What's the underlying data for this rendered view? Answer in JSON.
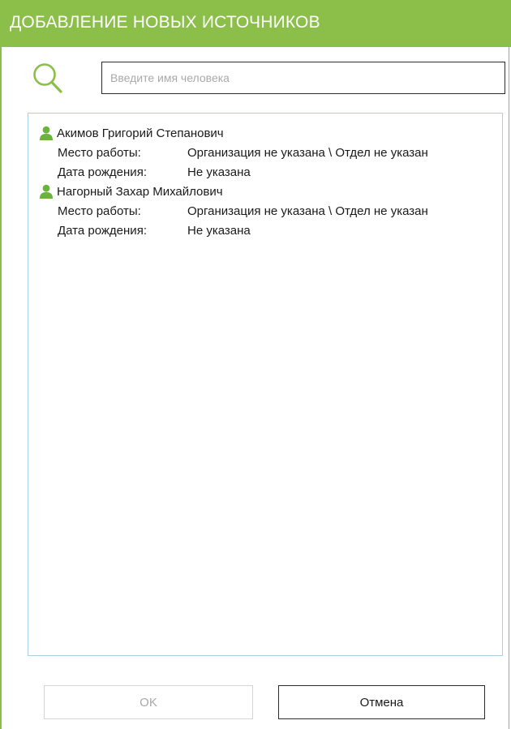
{
  "window": {
    "title": "ДОБАВЛЕНИЕ НОВЫХ ИСТОЧНИКОВ",
    "accent_color": "#8bbf4a"
  },
  "search": {
    "placeholder": "Введите имя человека",
    "value": "",
    "icon": "search-icon"
  },
  "people": [
    {
      "name": "Акимов Григорий Степанович",
      "icon": "person-icon",
      "workplace_label": "Место работы:",
      "workplace_value": "Организация не указана \\ Отдел не указан",
      "birthdate_label": "Дата рождения:",
      "birthdate_value": "Не указана"
    },
    {
      "name": "Нагорный Захар Михайлович",
      "icon": "person-icon",
      "workplace_label": "Место работы:",
      "workplace_value": "Организация не указана \\ Отдел не указан",
      "birthdate_label": "Дата рождения:",
      "birthdate_value": "Не указана"
    }
  ],
  "buttons": {
    "ok_label": "OK",
    "ok_enabled": false,
    "cancel_label": "Отмена"
  }
}
